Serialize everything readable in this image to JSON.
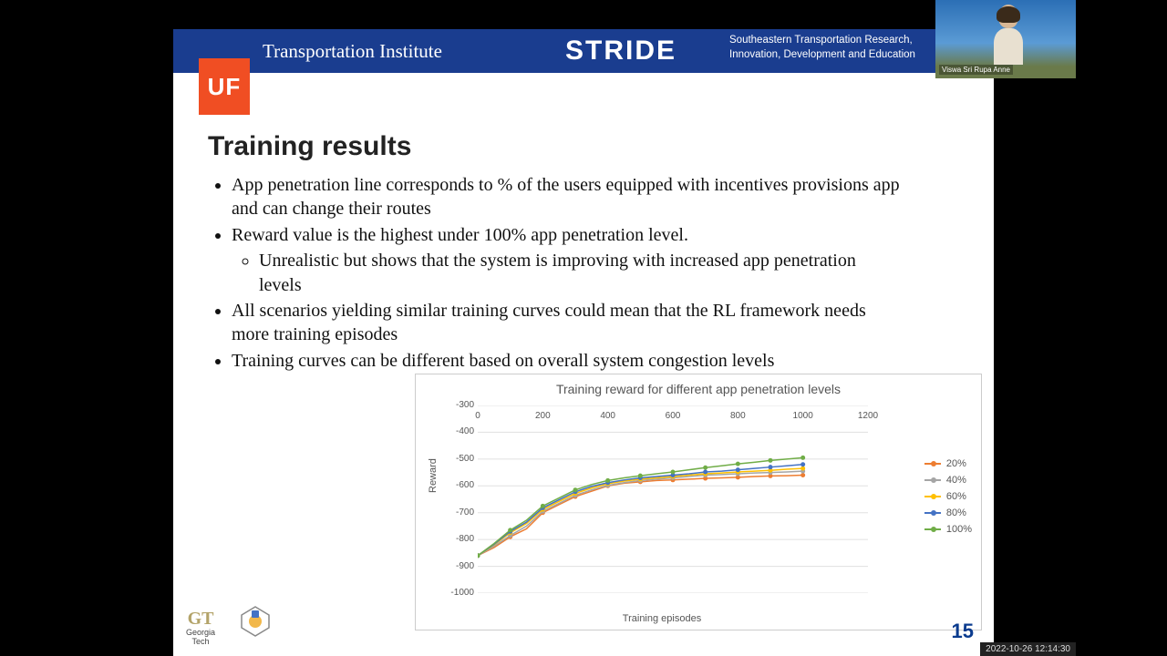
{
  "header": {
    "uf": "UF",
    "ti": "Transportation Institute",
    "stride": "STRIDE",
    "sub1": "Southeastern Transportation Research,",
    "sub2": "Innovation, Development and Education"
  },
  "title": "Training results",
  "bullets": {
    "b1": "App penetration line corresponds to % of the users equipped with incentives provisions app and can change their routes",
    "b2": "Reward value is the highest under 100% app penetration level.",
    "b2a": "Unrealistic but shows that the system is improving with increased app penetration levels",
    "b3": "All scenarios yielding similar training curves could mean that the RL framework needs more training episodes",
    "b4": "Training curves can be different based on overall system congestion levels"
  },
  "chart_data": {
    "type": "line",
    "title": "Training reward for different app penetration levels",
    "xlabel": "Training episodes",
    "ylabel": "Reward",
    "xlim": [
      0,
      1200
    ],
    "ylim": [
      -1000,
      -300
    ],
    "xticks": [
      0,
      200,
      400,
      600,
      800,
      1000,
      1200
    ],
    "yticks": [
      -300,
      -400,
      -500,
      -600,
      -700,
      -800,
      -900,
      -1000
    ],
    "x": [
      0,
      50,
      100,
      150,
      200,
      250,
      300,
      350,
      400,
      450,
      500,
      550,
      600,
      650,
      700,
      750,
      800,
      850,
      900,
      950,
      1000
    ],
    "series": [
      {
        "name": "20%",
        "color": "#ed7d31",
        "values": [
          -860,
          -830,
          -790,
          -760,
          -700,
          -670,
          -640,
          -620,
          -600,
          -590,
          -585,
          -580,
          -578,
          -575,
          -572,
          -570,
          -568,
          -565,
          -563,
          -562,
          -560
        ]
      },
      {
        "name": "40%",
        "color": "#a5a5a5",
        "values": [
          -860,
          -825,
          -785,
          -750,
          -695,
          -665,
          -635,
          -615,
          -598,
          -588,
          -580,
          -575,
          -570,
          -565,
          -560,
          -558,
          -555,
          -552,
          -550,
          -548,
          -545
        ]
      },
      {
        "name": "60%",
        "color": "#ffc000",
        "values": [
          -860,
          -820,
          -775,
          -740,
          -688,
          -658,
          -628,
          -608,
          -592,
          -582,
          -575,
          -570,
          -565,
          -560,
          -555,
          -552,
          -548,
          -545,
          -542,
          -538,
          -535
        ]
      },
      {
        "name": "80%",
        "color": "#4472c4",
        "values": [
          -860,
          -818,
          -770,
          -735,
          -682,
          -652,
          -622,
          -602,
          -588,
          -578,
          -570,
          -565,
          -560,
          -555,
          -548,
          -545,
          -540,
          -535,
          -530,
          -525,
          -520
        ]
      },
      {
        "name": "100%",
        "color": "#70ad47",
        "values": [
          -860,
          -815,
          -765,
          -728,
          -675,
          -645,
          -615,
          -595,
          -580,
          -570,
          -562,
          -555,
          -548,
          -540,
          -532,
          -525,
          -518,
          -512,
          -505,
          -500,
          -495
        ]
      }
    ]
  },
  "slidenum": "15",
  "gt": {
    "logo": "GT",
    "name": "Georgia\nTech"
  },
  "webcam_name": "Viswa Sri Rupa Anne",
  "timestamp": "2022-10-26  12:14:30"
}
